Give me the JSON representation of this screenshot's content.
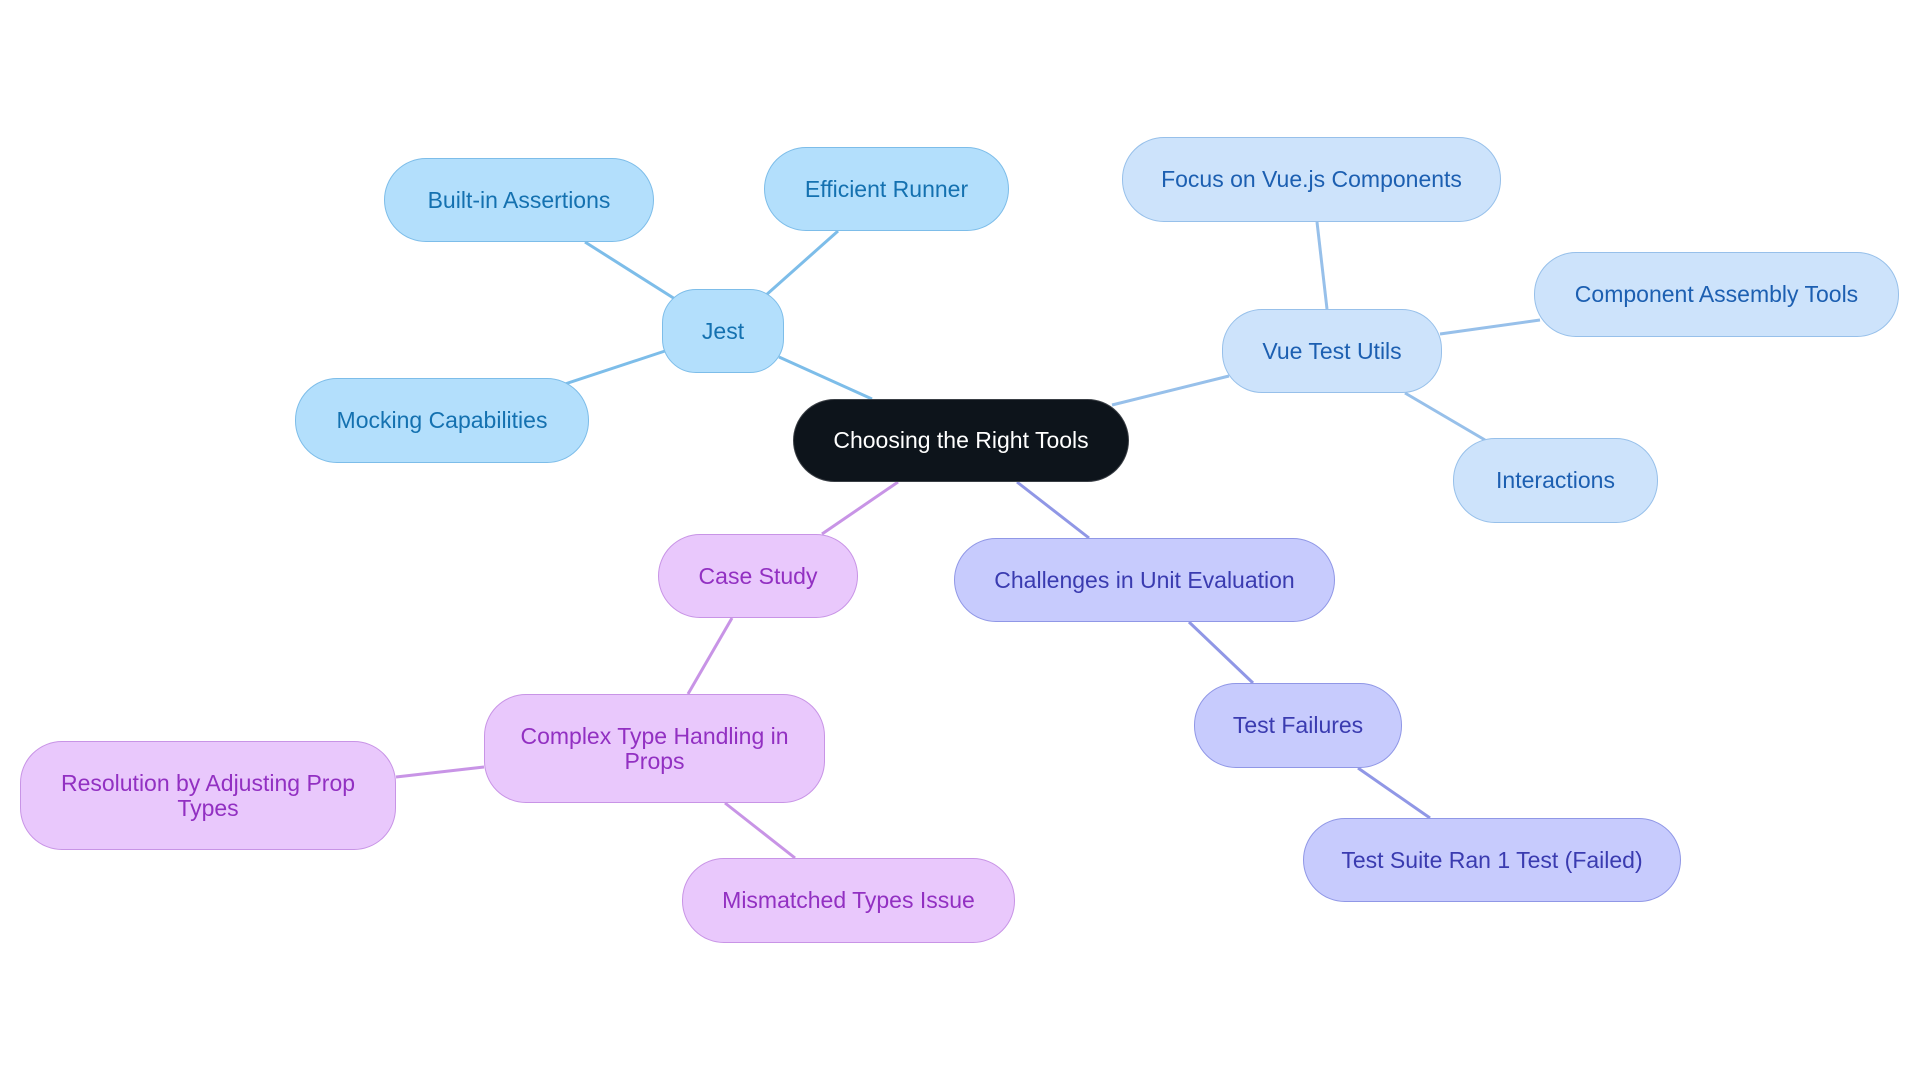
{
  "diagram": {
    "type": "mindmap",
    "root": {
      "id": "root",
      "label": "Choosing the Right Tools"
    },
    "branches": [
      {
        "id": "jest",
        "label": "Jest",
        "color": "#7dbde9",
        "children": [
          {
            "id": "built-in-assertions",
            "label": "Built-in Assertions"
          },
          {
            "id": "efficient-runner",
            "label": "Efficient Runner"
          },
          {
            "id": "mocking-capabilities",
            "label": "Mocking Capabilities"
          }
        ]
      },
      {
        "id": "vue-test-utils",
        "label": "Vue Test Utils",
        "color": "#97c0ea",
        "children": [
          {
            "id": "focus-on-vuejs-components",
            "label": "Focus on Vue.js Components"
          },
          {
            "id": "component-assembly-tools",
            "label": "Component Assembly Tools"
          },
          {
            "id": "interactions",
            "label": "Interactions"
          }
        ]
      },
      {
        "id": "case-study",
        "label": "Case Study",
        "color": "#c894e6",
        "children": [
          {
            "id": "complex-type-handling",
            "label": "Complex Type Handling in Props",
            "children": [
              {
                "id": "resolution-adjusting-prop-types",
                "label": "Resolution by Adjusting Prop Types"
              },
              {
                "id": "mismatched-types-issue",
                "label": "Mismatched Types Issue"
              }
            ]
          }
        ]
      },
      {
        "id": "challenges",
        "label": "Challenges in Unit Evaluation",
        "color": "#9097e6",
        "children": [
          {
            "id": "test-failures",
            "label": "Test Failures",
            "children": [
              {
                "id": "test-suite-failed",
                "label": "Test Suite Ran 1 Test (Failed)"
              }
            ]
          }
        ]
      }
    ]
  },
  "labels": {
    "root": "Choosing the Right Tools",
    "jest": "Jest",
    "built_in_assertions": "Built-in Assertions",
    "efficient_runner": "Efficient Runner",
    "mocking_capabilities": "Mocking Capabilities",
    "vue_test_utils": "Vue Test Utils",
    "focus_vue": "Focus on Vue.js Components",
    "component_assembly": "Component Assembly Tools",
    "interactions": "Interactions",
    "case_study": "Case Study",
    "complex_type": "Complex Type Handling in Props",
    "resolution": "Resolution by Adjusting Prop Types",
    "mismatched": "Mismatched Types Issue",
    "challenges": "Challenges in Unit Evaluation",
    "test_failures": "Test Failures",
    "test_suite": "Test Suite Ran 1 Test (Failed)"
  },
  "colors": {
    "root_fill": "#0d141b",
    "jest_branch": "#7dbde9",
    "vue_branch": "#97c0ea",
    "case_study_branch": "#c894e6",
    "challenges_branch": "#9097e6"
  }
}
